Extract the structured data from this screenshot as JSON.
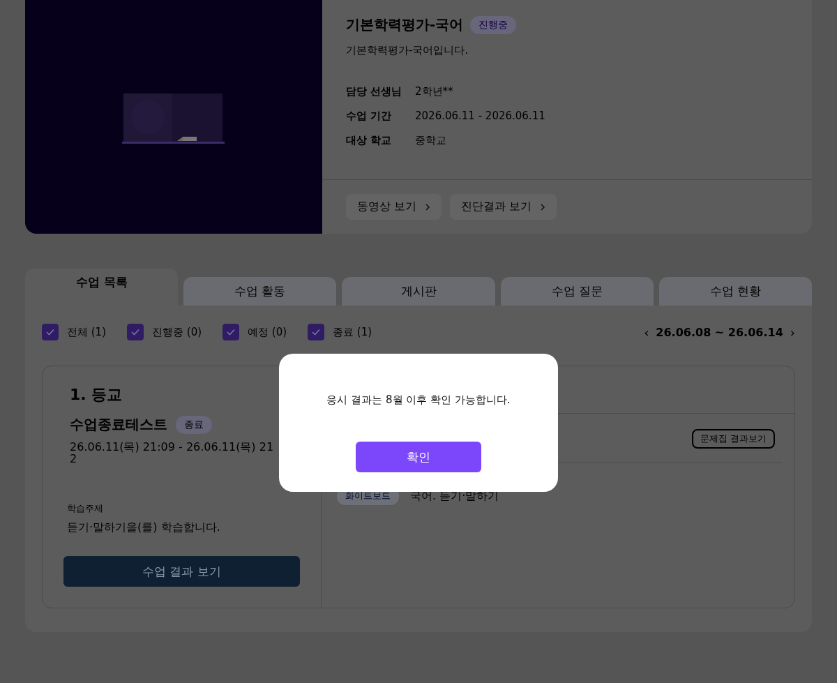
{
  "course": {
    "title": "기본학력평가-국어",
    "status": "진행중",
    "description": "기본학력평가-국어입니다.",
    "info": [
      {
        "label": "담당 선생님",
        "value": "2학년**"
      },
      {
        "label": "수업 기간",
        "value": "2026.06.11 - 2026.06.11"
      },
      {
        "label": "대상 학교",
        "value": "중학교"
      }
    ],
    "actions": [
      "동영상 보기",
      "진단결과 보기"
    ],
    "media": {
      "kind": "picture"
    }
  },
  "tabs": [
    {
      "label": "수업 목록",
      "selected": true
    },
    {
      "label": "수업 활동",
      "selected": false
    },
    {
      "label": "게시판",
      "selected": false
    },
    {
      "label": "수업 질문",
      "selected": false
    },
    {
      "label": "수업 현황",
      "selected": false
    }
  ],
  "filters": [
    {
      "label": "전체 (1)",
      "checked": true
    },
    {
      "label": "진행중 (0)",
      "checked": true
    },
    {
      "label": "예정 (0)",
      "checked": true
    },
    {
      "label": "종료 (1)",
      "checked": true
    }
  ],
  "date_range": {
    "prev": "‹",
    "label": "26.06.08 ~ 26.06.14",
    "next": "›"
  },
  "lesson": {
    "number": "1. 등교",
    "title": "수업종료테스트",
    "status": "종료",
    "time_lines": [
      "26.06.11(목) 21:09 - 26.06.11(목) 21",
      "2"
    ],
    "topic_label": "학습주제",
    "topic": "듣기·말하기을(를) 학습합니다.",
    "result_button": "수업 결과 보기",
    "workbook_button": "문제집 결과보기",
    "activity": {
      "tag": "화이트보드",
      "title": "국어. 듣기·말하기"
    }
  },
  "dialog": {
    "message": "응시 결과는 8월 이후 확인 가능합니다.",
    "confirm": "확인"
  }
}
